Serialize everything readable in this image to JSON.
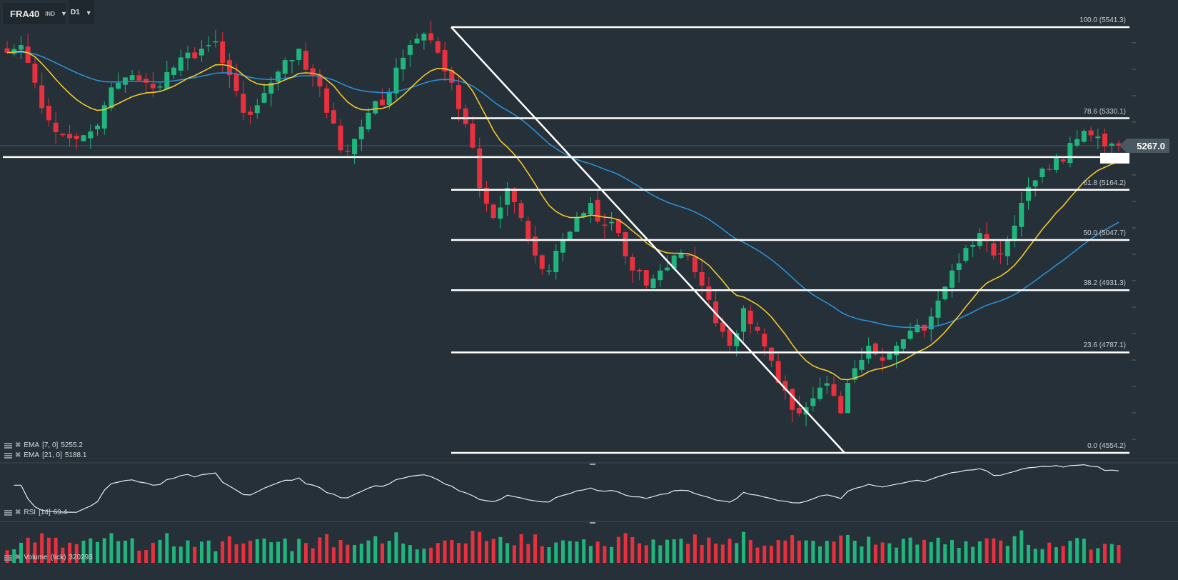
{
  "symbol": {
    "name": "FRA40",
    "type": "IND",
    "timeframe": "D1"
  },
  "current_price": "5267.0",
  "colors": {
    "bg": "#263038",
    "up": "#1fb57d",
    "down": "#e8303e",
    "ema_fast": "#f2c82a",
    "ema_slow": "#2a8fd4",
    "fib": "#ffffff"
  },
  "indicators": {
    "ema7": {
      "name": "EMA",
      "params": "[7, 0]",
      "value": "5255.2"
    },
    "ema21": {
      "name": "EMA",
      "params": "[21, 0]",
      "value": "5188.1"
    },
    "rsi": {
      "name": "RSI",
      "params": "[14]",
      "value": "69.4"
    },
    "volume": {
      "name": "Volume",
      "params": "(tick)",
      "value": "320293"
    }
  },
  "fib_levels": [
    {
      "label": "100.0 (5541.3)",
      "price": 5541.3
    },
    {
      "label": "78.6 (5330.1)",
      "price": 5330.1
    },
    {
      "label": "61.8 (5164.2)",
      "price": 5164.2
    },
    {
      "label": "50.0 (5047.7)",
      "price": 5047.7
    },
    {
      "label": "38.2 (4931.3)",
      "price": 4931.3
    },
    {
      "label": "23.6 (4787.1)",
      "price": 4787.1
    },
    {
      "label": "0.0 (4554.2)",
      "price": 4554.2
    }
  ],
  "support_price": 5240,
  "chart_data": {
    "type": "candlestick",
    "price_range": [
      4554.2,
      5541.3
    ],
    "closes": [
      5482.2,
      5499.7,
      5412.5,
      5325.4,
      5290.6,
      5281.9,
      5299.3,
      5360.3,
      5412.5,
      5430,
      5412.5,
      5403.8,
      5447.4,
      5482.2,
      5491,
      5508.4,
      5430,
      5342.9,
      5360.3,
      5412.5,
      5464.8,
      5491,
      5430,
      5342.9,
      5255.7,
      5281.9,
      5342.9,
      5360.3,
      5447.4,
      5499.7,
      5525.8,
      5482.2,
      5412.5,
      5316.7,
      5168.6,
      5099,
      5168.6,
      5099,
      5011.8,
      4977,
      5046.7,
      5099,
      5133.8,
      5081.5,
      5064.1,
      4977,
      4942.1,
      4977,
      5011.8,
      5011.8,
      4942.1,
      4855,
      4802.7,
      4890,
      4837.6,
      4768,
      4698.2,
      4646,
      4680.8,
      4715.6,
      4646,
      4750.5,
      4802.7,
      4768,
      4802.7,
      4837.6,
      4837.6,
      4907.3,
      4977,
      5029.3,
      5064.1,
      5011.8,
      5046.7,
      5133.8,
      5186,
      5212.2,
      5229.6,
      5281.9,
      5290.6,
      5264.5,
      5267
    ]
  }
}
